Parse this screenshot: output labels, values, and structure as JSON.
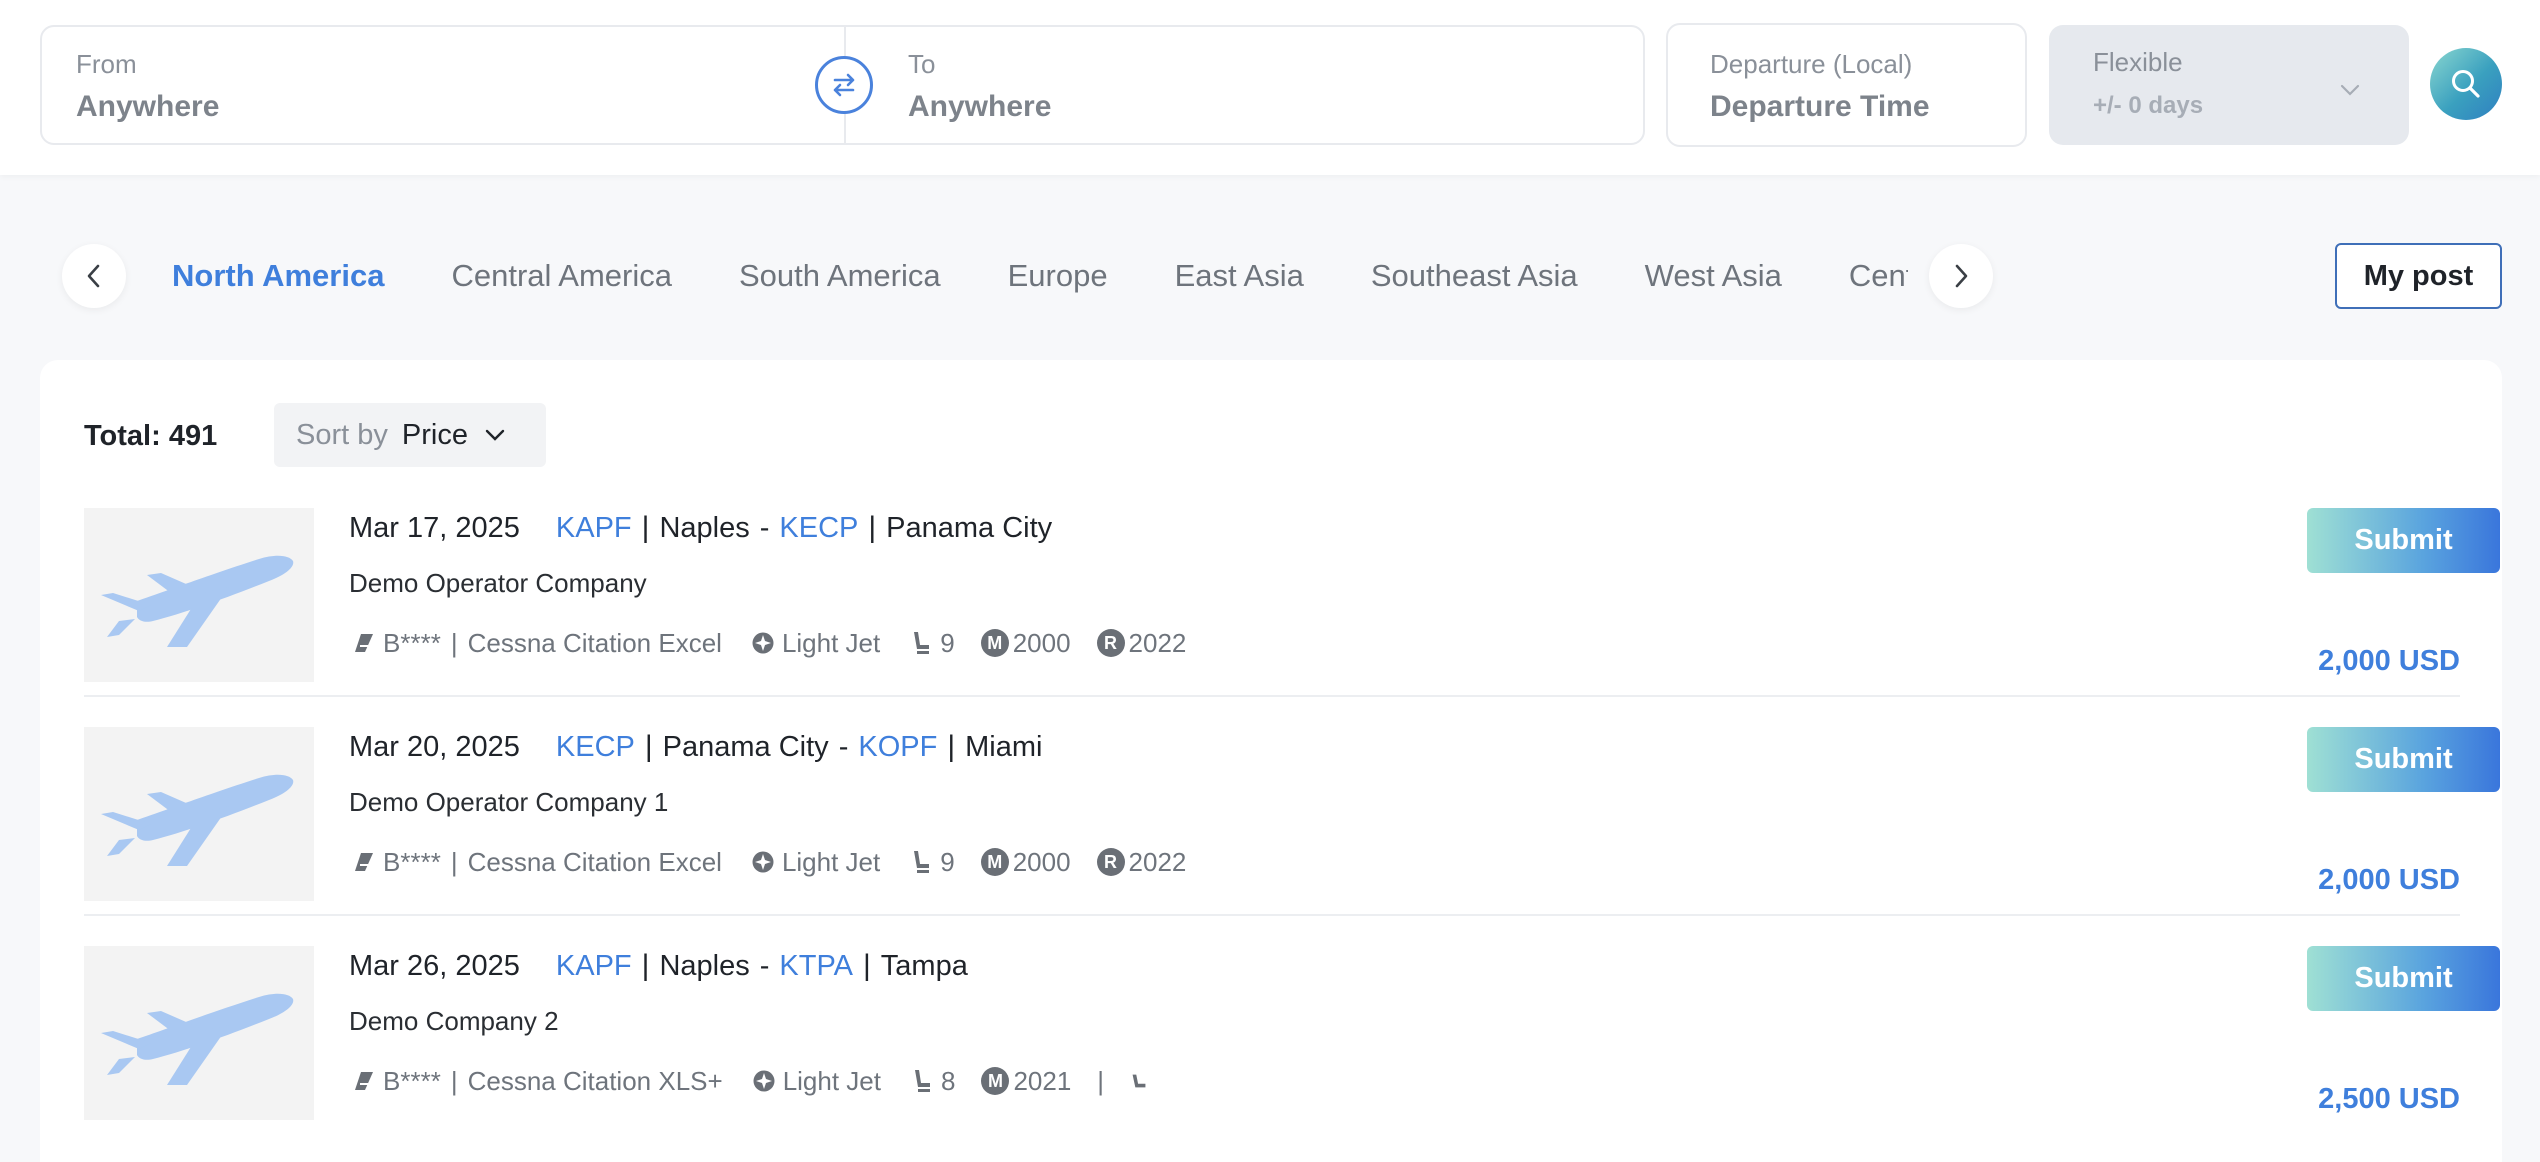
{
  "search": {
    "from_label": "From",
    "from_value": "Anywhere",
    "to_label": "To",
    "to_value": "Anywhere",
    "departure_label": "Departure (Local)",
    "departure_value": "Departure Time",
    "flexible_label": "Flexible",
    "flexible_value": "+/- 0 days"
  },
  "regions": {
    "active_index": 0,
    "tabs": [
      "North America",
      "Central America",
      "South America",
      "Europe",
      "East Asia",
      "Southeast Asia",
      "West Asia",
      "Central Asia"
    ]
  },
  "my_post_label": "My post",
  "results": {
    "total_text": "Total: 491",
    "sort_label": "Sort by",
    "sort_value": "Price",
    "flights": [
      {
        "date": "Mar 17, 2025",
        "from_code": "KAPF",
        "from_city": "Naples",
        "to_code": "KECP",
        "to_city": "Panama City",
        "operator": "Demo Operator Company",
        "registration": "B****",
        "aircraft": "Cessna Citation Excel",
        "category": "Light Jet",
        "seats": "9",
        "manufactured": "2000",
        "refurbished": "2022",
        "submit_label": "Submit",
        "price": "2,000 USD"
      },
      {
        "date": "Mar 20, 2025",
        "from_code": "KECP",
        "from_city": "Panama City",
        "to_code": "KOPF",
        "to_city": "Miami",
        "operator": "Demo Operator Company 1",
        "registration": "B****",
        "aircraft": "Cessna Citation Excel",
        "category": "Light Jet",
        "seats": "9",
        "manufactured": "2000",
        "refurbished": "2022",
        "submit_label": "Submit",
        "price": "2,000 USD"
      },
      {
        "date": "Mar 26, 2025",
        "from_code": "KAPF",
        "from_city": "Naples",
        "to_code": "KTPA",
        "to_city": "Tampa",
        "operator": "Demo Company 2",
        "registration": "B****",
        "aircraft": "Cessna Citation XLS+",
        "category": "Light Jet",
        "seats": "8",
        "manufactured": "2021",
        "submit_label": "Submit",
        "price": "2,500 USD"
      }
    ]
  },
  "colors": {
    "accent": "#3f7fdc",
    "submit_gradient_start": "#9fe0d4",
    "submit_gradient_end": "#3a76dc"
  },
  "icons": [
    "swap-icon",
    "chevron-down-icon",
    "search-icon",
    "chevron-left-icon",
    "chevron-right-icon",
    "airplane-icon",
    "tail-icon",
    "jet-category-icon",
    "seat-icon",
    "manufactured-badge-icon",
    "refurbished-badge-icon"
  ]
}
